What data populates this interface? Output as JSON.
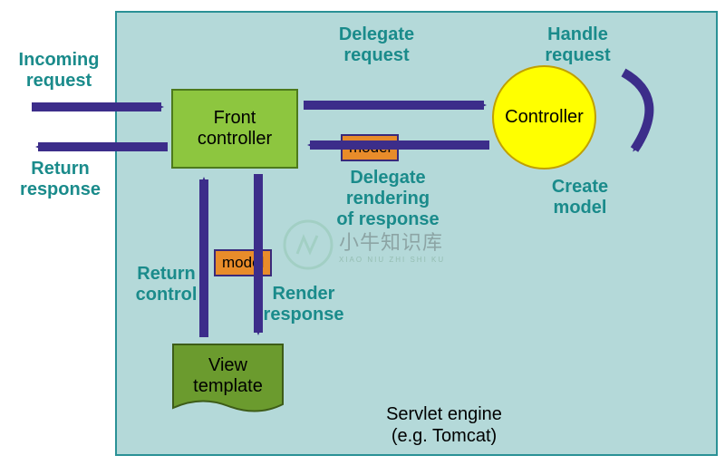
{
  "labels": {
    "incoming_request": "Incoming\nrequest",
    "return_response": "Return\nresponse",
    "delegate_request": "Delegate\nrequest",
    "handle_request": "Handle\nrequest",
    "delegate_rendering": "Delegate\nrendering\nof response",
    "create_model": "Create\nmodel",
    "return_control": "Return\ncontrol",
    "render_response": "Render\nresponse"
  },
  "nodes": {
    "front_controller": "Front\ncontroller",
    "controller": "Controller",
    "view_template": "View\ntemplate",
    "model": "model"
  },
  "caption": "Servlet engine\n(e.g. Tomcat)",
  "watermark": {
    "title": "小牛知识库",
    "subtitle": "XIAO NIU ZHI SHI KU"
  },
  "colors": {
    "arrow": "#3c2d8a",
    "teal_text": "#1a8b8b",
    "container_bg": "#b4d9d9",
    "container_border": "#2a9196",
    "front_bg": "#8dc63f",
    "controller_bg": "#ffff00",
    "view_bg": "#6b9b2e",
    "model_bg": "#e88c2a"
  }
}
